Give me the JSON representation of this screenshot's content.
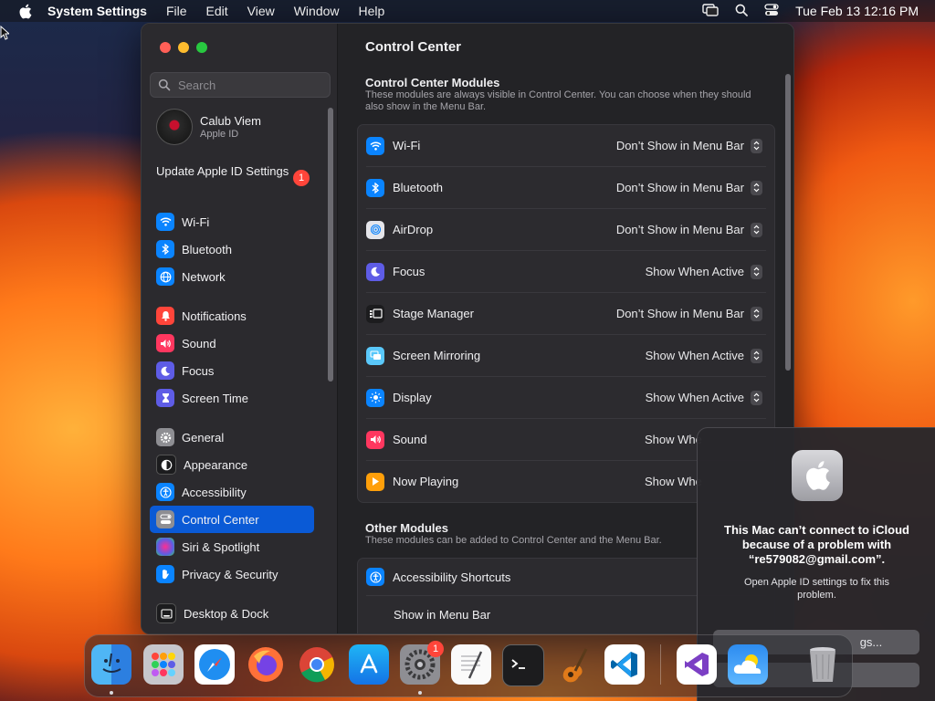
{
  "menubar": {
    "app_name": "System Settings",
    "menus": [
      "File",
      "Edit",
      "View",
      "Window",
      "Help"
    ],
    "clock": "Tue Feb 13  12:16 PM"
  },
  "sidebar": {
    "search_placeholder": "Search",
    "profile": {
      "name": "Calub Viem",
      "subtitle": "Apple ID"
    },
    "update": {
      "label": "Update Apple ID Settings",
      "badge": "1"
    },
    "items": [
      {
        "label": "Wi-Fi",
        "icon": "wifi-icon",
        "color": "#0a84ff"
      },
      {
        "label": "Bluetooth",
        "icon": "bluetooth-icon",
        "color": "#0a84ff"
      },
      {
        "label": "Network",
        "icon": "globe-icon",
        "color": "#0a84ff"
      },
      {
        "label": "Notifications",
        "icon": "bell-icon",
        "color": "#ff453a"
      },
      {
        "label": "Sound",
        "icon": "speaker-icon",
        "color": "#ff375f"
      },
      {
        "label": "Focus",
        "icon": "moon-icon",
        "color": "#5e5ce6"
      },
      {
        "label": "Screen Time",
        "icon": "hourglass-icon",
        "color": "#5e5ce6"
      },
      {
        "label": "General",
        "icon": "gear-icon",
        "color": "#8e8e93"
      },
      {
        "label": "Appearance",
        "icon": "appearance-icon",
        "color": "#1c1c1e"
      },
      {
        "label": "Accessibility",
        "icon": "accessibility-icon",
        "color": "#0a84ff"
      },
      {
        "label": "Control Center",
        "icon": "control-center-icon",
        "color": "#8e8e93"
      },
      {
        "label": "Siri & Spotlight",
        "icon": "siri-icon",
        "color": "#bf5af2"
      },
      {
        "label": "Privacy & Security",
        "icon": "hand-icon",
        "color": "#0a84ff"
      },
      {
        "label": "Desktop & Dock",
        "icon": "dock-icon",
        "color": "#1c1c1e"
      }
    ]
  },
  "content": {
    "title": "Control Center",
    "modules": {
      "title": "Control Center Modules",
      "desc": "These modules are always visible in Control Center. You can choose when they should also show in the Menu Bar.",
      "rows": [
        {
          "label": "Wi-Fi",
          "value": "Don’t Show in Menu Bar",
          "icon": "wifi-icon",
          "color": "#0a84ff"
        },
        {
          "label": "Bluetooth",
          "value": "Don’t Show in Menu Bar",
          "icon": "bluetooth-icon",
          "color": "#0a84ff"
        },
        {
          "label": "AirDrop",
          "value": "Don’t Show in Menu Bar",
          "icon": "airdrop-icon",
          "color": "#e5e5ea"
        },
        {
          "label": "Focus",
          "value": "Show When Active",
          "icon": "moon-icon",
          "color": "#5e5ce6"
        },
        {
          "label": "Stage Manager",
          "value": "Don’t Show in Menu Bar",
          "icon": "stage-manager-icon",
          "color": "#1c1c1e"
        },
        {
          "label": "Screen Mirroring",
          "value": "Show When Active",
          "icon": "screen-mirroring-icon",
          "color": "#5ac8fa"
        },
        {
          "label": "Display",
          "value": "Show When Active",
          "icon": "sun-icon",
          "color": "#0a84ff"
        },
        {
          "label": "Sound",
          "value": "Show Whe",
          "icon": "speaker-icon",
          "color": "#ff375f"
        },
        {
          "label": "Now Playing",
          "value": "Show Whe",
          "icon": "play-icon",
          "color": "#ff9f0a"
        }
      ]
    },
    "other": {
      "title": "Other Modules",
      "desc": "These modules can be added to Control Center and the Menu Bar.",
      "rows": [
        {
          "label": "Accessibility Shortcuts",
          "icon": "accessibility-icon",
          "color": "#0a84ff"
        },
        {
          "label": "Show in Menu Bar"
        }
      ]
    }
  },
  "notification": {
    "title": "This Mac can’t connect to iCloud because of a problem with “re579082@gmail.com”.",
    "body": "Open Apple ID settings to fix this problem.",
    "button1": "gs..."
  },
  "dock": {
    "settings_badge": "1",
    "apps": [
      "Finder",
      "Launchpad",
      "Safari",
      "Firefox",
      "Chrome",
      "App Store",
      "System Settings",
      "TextEdit",
      "Terminal",
      "GarageBand",
      "Visual Studio Code",
      "Visual Studio",
      "Weather",
      "Trash"
    ]
  }
}
